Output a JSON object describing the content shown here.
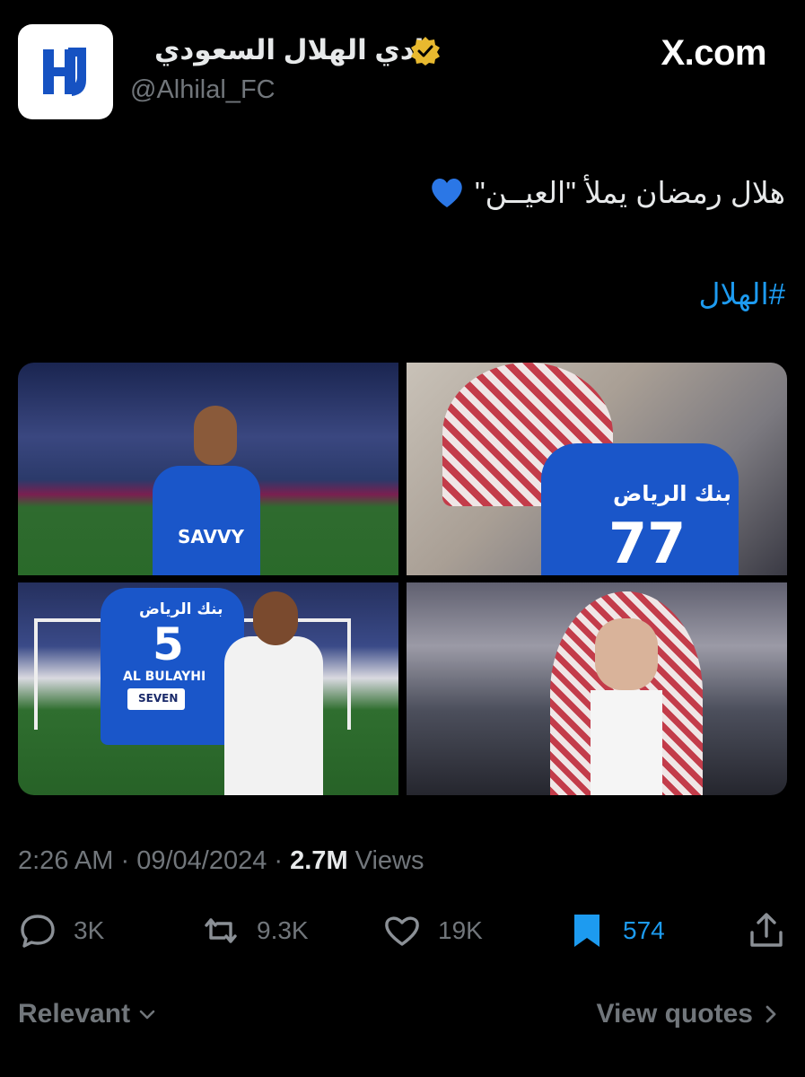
{
  "header": {
    "display_name": "نادي الهلال السعودي",
    "handle": "@Alhilal_FC",
    "site": "X.com"
  },
  "tweet": {
    "text": "هلال رمضان يملأ \"العيــن\"",
    "hashtag": "#الهلال"
  },
  "photos": {
    "p1_jersey_brand": "SAVVY",
    "p2_jersey_sponsor": "بنك الرياض",
    "p2_jersey_number": "77",
    "p3_jersey_sponsor": "بنك الرياض",
    "p3_jersey_number": "5",
    "p3_jersey_name": "AL BULAYHI",
    "p3_jersey_badge": "SEVEN"
  },
  "meta": {
    "time": "2:26 AM",
    "date": "09/04/2024",
    "views_count": "2.7M",
    "views_label": "Views"
  },
  "actions": {
    "replies": "3K",
    "reposts": "9.3K",
    "likes": "19K",
    "bookmarks": "574"
  },
  "footer": {
    "sort_label": "Relevant",
    "quotes_label": "View quotes"
  },
  "colors": {
    "background": "#000000",
    "accent": "#1d9bf0",
    "bookmark": "#1d9bf0",
    "verified": "#e8b92f",
    "heart_emoji": "#2b77e6"
  }
}
